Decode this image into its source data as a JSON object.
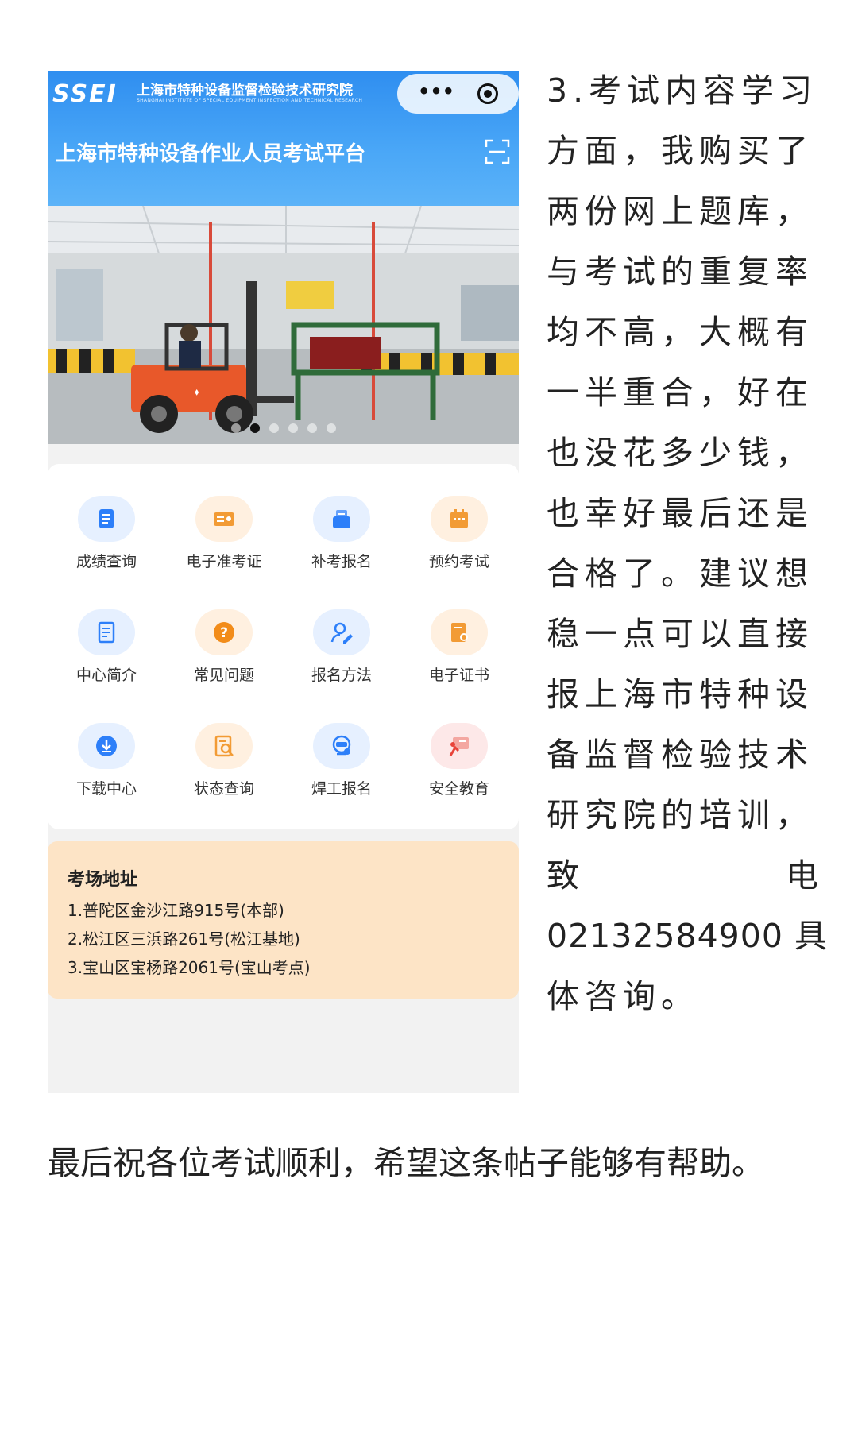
{
  "app": {
    "logo": "SSEI",
    "org_name": "上海市特种设备监督检验技术研究院",
    "org_name_en": "SHANGHAI INSTITUTE OF SPECIAL EQUIPMENT INSPECTION AND TECHNICAL RESEARCH",
    "platform_title": "上海市特种设备作业人员考试平台",
    "carousel": {
      "count": 6,
      "active_index": 1
    },
    "menu": [
      {
        "label": "成绩查询",
        "icon": "score-query-icon",
        "color": "#2d7ff9",
        "bg": "#e6f0ff"
      },
      {
        "label": "电子准考证",
        "icon": "admission-ticket-icon",
        "color": "#f29b35",
        "bg": "#fff0e0"
      },
      {
        "label": "补考报名",
        "icon": "retake-register-icon",
        "color": "#2d7ff9",
        "bg": "#e6f0ff"
      },
      {
        "label": "预约考试",
        "icon": "calendar-icon",
        "color": "#f29b35",
        "bg": "#fff0e0"
      },
      {
        "label": "中心简介",
        "icon": "document-icon",
        "color": "#2d7ff9",
        "bg": "#e6f0ff"
      },
      {
        "label": "常见问题",
        "icon": "question-icon",
        "color": "#f28c1a",
        "bg": "#fff0e0"
      },
      {
        "label": "报名方法",
        "icon": "user-edit-icon",
        "color": "#2d7ff9",
        "bg": "#e6f0ff"
      },
      {
        "label": "电子证书",
        "icon": "certificate-icon",
        "color": "#f29b35",
        "bg": "#fff0e0"
      },
      {
        "label": "下载中心",
        "icon": "download-icon",
        "color": "#2d7ff9",
        "bg": "#e6f0ff"
      },
      {
        "label": "状态查询",
        "icon": "status-search-icon",
        "color": "#f29b35",
        "bg": "#fff0e0"
      },
      {
        "label": "焊工报名",
        "icon": "welder-icon",
        "color": "#2d7ff9",
        "bg": "#e6f0ff"
      },
      {
        "label": "安全教育",
        "icon": "safety-education-icon",
        "color": "#e8443a",
        "bg": "#fde8e8"
      }
    ],
    "address": {
      "title": "考场地址",
      "lines": [
        "1.普陀区金沙江路915号(本部)",
        "2.松江区三浜路261号(松江基地)",
        "3.宝山区宝杨路2061号(宝山考点)"
      ]
    }
  },
  "article": {
    "lines": [
      "3.考试内容学习",
      "方面，我购买了",
      "两份网上题库，",
      "与考试的重复率",
      "均不高，大概有",
      "一半重合，好在",
      "也没花多少钱，",
      "也幸好最后还是",
      "合格了。建议想",
      "稳一点可以直接",
      "报上海市特种设",
      "备监督检验技术",
      "研究院的培训，"
    ],
    "phone_line": {
      "left": "致",
      "right": "电"
    },
    "phone_number_line": "02132584900 具",
    "last_line": "体咨询。",
    "closing": "最后祝各位考试顺利，希望这条帖子能够有帮助。"
  }
}
